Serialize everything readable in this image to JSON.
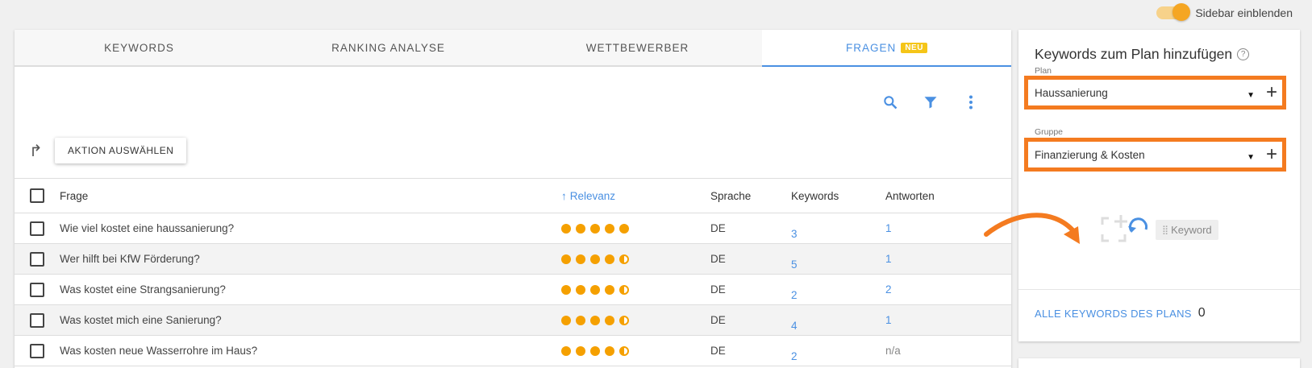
{
  "topbar": {
    "toggle_label": "Sidebar einblenden",
    "toggle_on": true
  },
  "tabs": [
    {
      "label": "Keywords",
      "active": false
    },
    {
      "label": "Ranking Analyse",
      "active": false
    },
    {
      "label": "Wettbewerber",
      "active": false
    },
    {
      "label": "Fragen",
      "active": true,
      "badge": "NEU"
    }
  ],
  "toolbar": {
    "action_label": "AKTION AUSWÄHLEN"
  },
  "table": {
    "headers": {
      "frage": "Frage",
      "relevanz": "Relevanz",
      "sprache": "Sprache",
      "keywords": "Keywords",
      "antworten": "Antworten"
    },
    "rows": [
      {
        "frage": "Wie viel kostet eine haussanierung?",
        "relevanz": 5,
        "sprache": "DE",
        "keywords": "3",
        "antworten": "1"
      },
      {
        "frage": "Wer hilft bei KfW Förderung?",
        "relevanz": 4.5,
        "sprache": "DE",
        "keywords": "5",
        "antworten": "1"
      },
      {
        "frage": "Was kostet eine Strangsanierung?",
        "relevanz": 4.5,
        "sprache": "DE",
        "keywords": "2",
        "antworten": "2"
      },
      {
        "frage": "Was kostet mich eine Sanierung?",
        "relevanz": 4.5,
        "sprache": "DE",
        "keywords": "4",
        "antworten": "1"
      },
      {
        "frage": "Was kosten neue Wasserrohre im Haus?",
        "relevanz": 4.5,
        "sprache": "DE",
        "keywords": "2",
        "antworten": "n/a"
      }
    ]
  },
  "sidebar": {
    "title": "Keywords zum Plan hinzufügen",
    "plan_label": "Plan",
    "plan_value": "Haussanierung",
    "gruppe_label": "Gruppe",
    "gruppe_value": "Finanzierung & Kosten",
    "hint_keyword": "Keyword",
    "all_keywords_link": "ALLE KEYWORDS DES PLANS",
    "all_keywords_count": "0"
  },
  "colors": {
    "accent": "#4a90e2",
    "highlight": "#f47b20",
    "star": "#f5a000",
    "badge": "#f5c518"
  }
}
